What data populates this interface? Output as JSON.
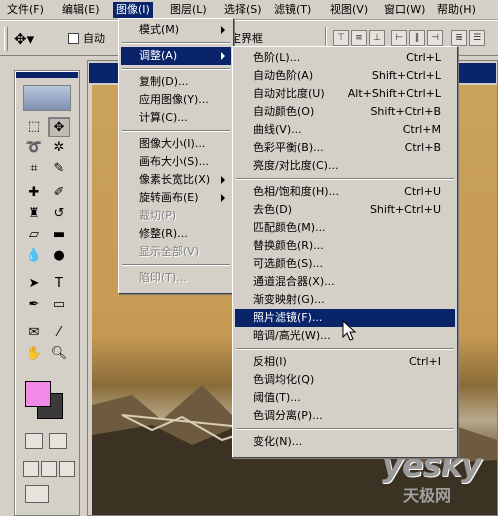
{
  "menubar": [
    {
      "label": "文件(F)",
      "active": false
    },
    {
      "label": "编辑(E)",
      "active": false
    },
    {
      "label": "图像(I)",
      "active": true
    },
    {
      "label": "图层(L)",
      "active": false
    },
    {
      "label": "选择(S)",
      "active": false
    },
    {
      "label": "滤镜(T)",
      "active": false
    },
    {
      "label": "视图(V)",
      "active": false
    },
    {
      "label": "窗口(W)",
      "active": false
    },
    {
      "label": "帮助(H)",
      "active": false
    }
  ],
  "options": {
    "auto_label": "自动",
    "bounds_label": "定界框"
  },
  "image_menu": [
    {
      "label": "模式(M)",
      "submenu": true
    },
    {
      "sep": true
    },
    {
      "label": "调整(A)",
      "submenu": true,
      "highlight": true
    },
    {
      "sep": true
    },
    {
      "label": "复制(D)..."
    },
    {
      "label": "应用图像(Y)..."
    },
    {
      "label": "计算(C)..."
    },
    {
      "sep": true
    },
    {
      "label": "图像大小(I)..."
    },
    {
      "label": "画布大小(S)..."
    },
    {
      "label": "像素长宽比(X)",
      "submenu": true
    },
    {
      "label": "旋转画布(E)",
      "submenu": true
    },
    {
      "label": "裁切(P)",
      "disabled": true
    },
    {
      "label": "修整(R)..."
    },
    {
      "label": "显示全部(V)",
      "disabled": true
    },
    {
      "sep": true
    },
    {
      "label": "陷印(T)...",
      "disabled": true
    }
  ],
  "adjust_menu": [
    {
      "label": "色阶(L)...",
      "shortcut": "Ctrl+L"
    },
    {
      "label": "自动色阶(A)",
      "shortcut": "Shift+Ctrl+L"
    },
    {
      "label": "自动对比度(U)",
      "shortcut": "Alt+Shift+Ctrl+L"
    },
    {
      "label": "自动颜色(O)",
      "shortcut": "Shift+Ctrl+B"
    },
    {
      "label": "曲线(V)...",
      "shortcut": "Ctrl+M"
    },
    {
      "label": "色彩平衡(B)...",
      "shortcut": "Ctrl+B"
    },
    {
      "label": "亮度/对比度(C)...",
      "shortcut": ""
    },
    {
      "sep": true
    },
    {
      "label": "色相/饱和度(H)...",
      "shortcut": "Ctrl+U"
    },
    {
      "label": "去色(D)",
      "shortcut": "Shift+Ctrl+U"
    },
    {
      "label": "匹配颜色(M)...",
      "shortcut": ""
    },
    {
      "label": "替换颜色(R)...",
      "shortcut": ""
    },
    {
      "label": "可选颜色(S)...",
      "shortcut": ""
    },
    {
      "label": "通道混合器(X)...",
      "shortcut": ""
    },
    {
      "label": "渐变映射(G)...",
      "shortcut": ""
    },
    {
      "label": "照片滤镜(F)...",
      "shortcut": "",
      "highlight": true
    },
    {
      "label": "暗调/高光(W)...",
      "shortcut": ""
    },
    {
      "sep": true
    },
    {
      "label": "反相(I)",
      "shortcut": "Ctrl+I"
    },
    {
      "label": "色调均化(Q)",
      "shortcut": ""
    },
    {
      "label": "阈值(T)...",
      "shortcut": ""
    },
    {
      "label": "色调分离(P)...",
      "shortcut": ""
    },
    {
      "sep": true
    },
    {
      "label": "变化(N)...",
      "shortcut": ""
    }
  ],
  "watermark": {
    "text": "yesky",
    "subtext": "天极网"
  },
  "colors": {
    "foreground": "#f08ae6",
    "background": "#3a3a3a",
    "highlight": "#0a246a"
  }
}
